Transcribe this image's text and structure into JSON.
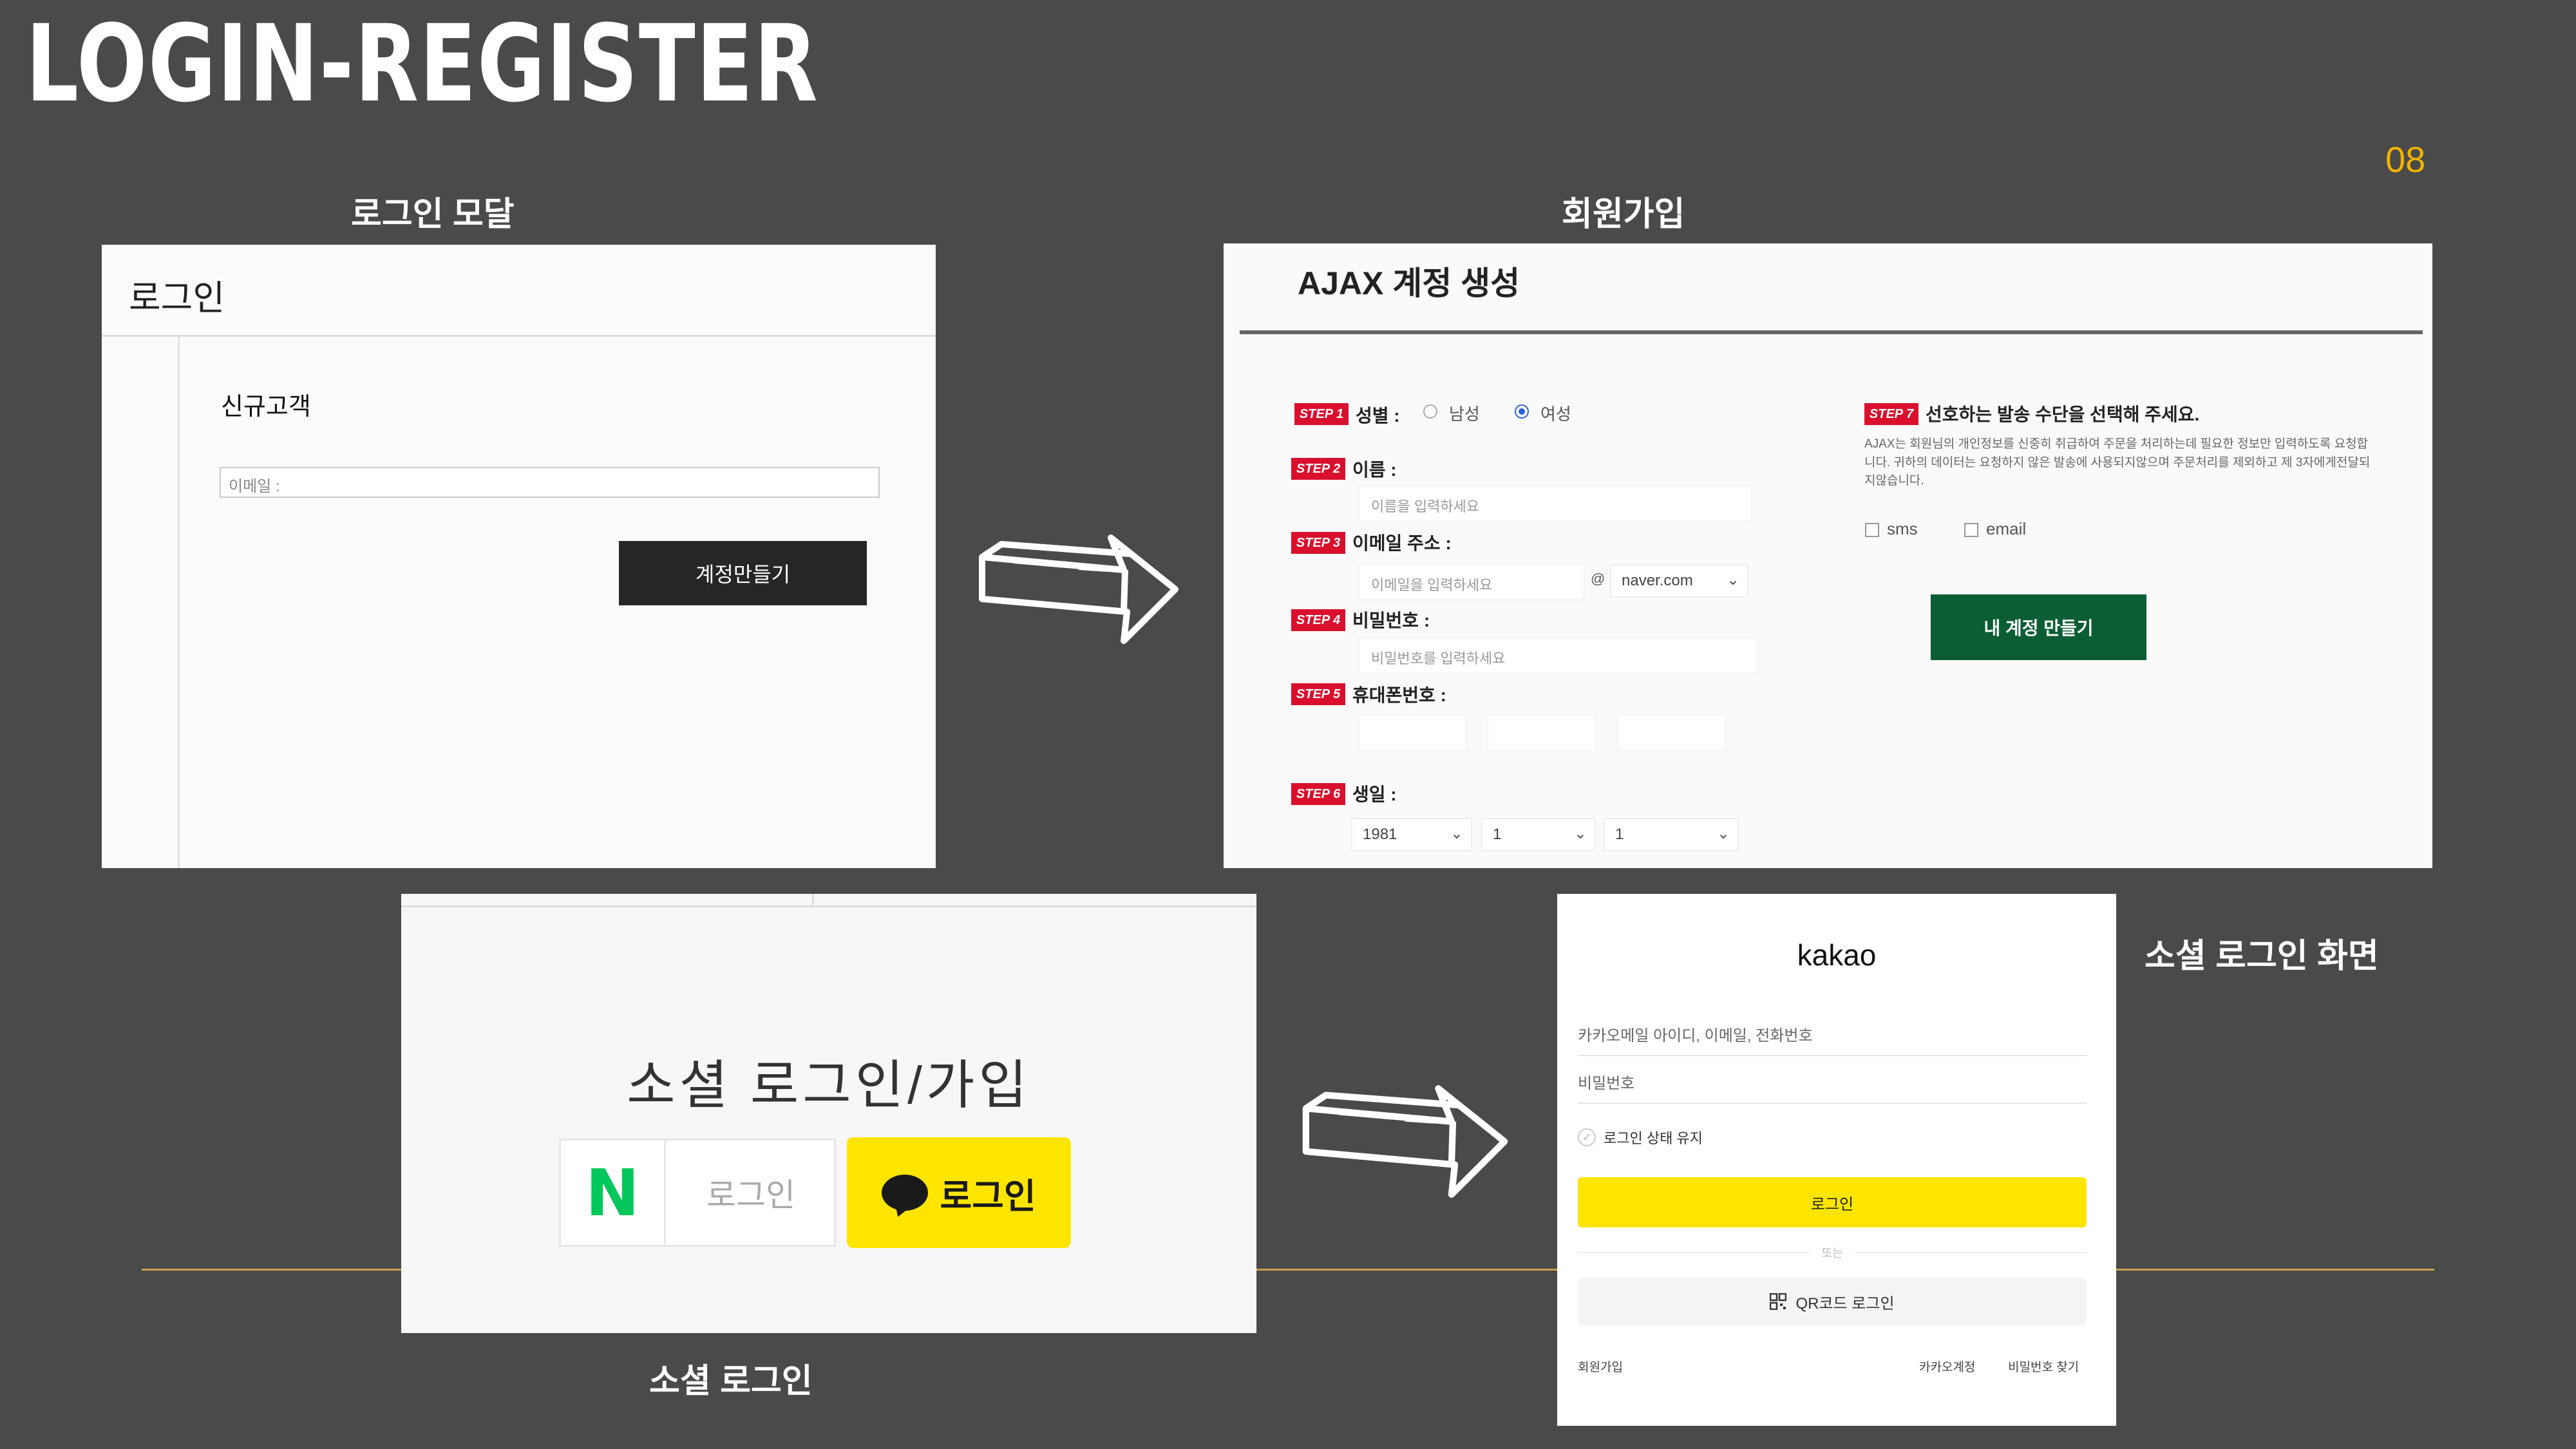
{
  "title": "LOGIN-REGISTER",
  "page_number": "08",
  "captions": {
    "login_modal": "로그인 모달",
    "register": "회원가입",
    "social_login": "소셜 로그인",
    "social_login_screen": "소셜 로그인 화면"
  },
  "login_modal": {
    "header": "로그인",
    "section": "신규고객",
    "email_placeholder": "이메일 :",
    "create_button": "계정만들기"
  },
  "register": {
    "title": "AJAX 계정 생성",
    "steps": {
      "s1": "STEP 1",
      "s2": "STEP 2",
      "s3": "STEP 3",
      "s4": "STEP 4",
      "s5": "STEP 5",
      "s6": "STEP 6",
      "s7": "STEP 7"
    },
    "gender_label": "성별 :",
    "gender_options": [
      "남성",
      "여성"
    ],
    "gender_selected": "여성",
    "name_label": "이름 :",
    "name_placeholder": "이름을 입력하세요",
    "email_label": "이메일 주소 :",
    "email_placeholder": "이메일을 입력하세요",
    "email_at": "@",
    "email_domain": "naver.com",
    "password_label": "비밀번호 :",
    "password_placeholder": "비밀번호를 입력하세요",
    "phone_label": "휴대폰번호 :",
    "birth_label": "생일 :",
    "birth_year": "1981",
    "birth_month": "1",
    "birth_day": "1",
    "preference_label": "선호하는 발송 수단을 선택해 주세요.",
    "preference_desc": "AJAX는 회원님의 개인정보를 신중히 취급하여 주문을 처리하는데 필요한 정보만 입력하도록 요청합니다. 귀하의 데이터는 요청하지 않은 발송에 사용되지않으며 주문처리를 제외하고 제 3자에게전달되지않습니다.",
    "option_sms": "sms",
    "option_email": "email",
    "submit_button": "내 계정 만들기"
  },
  "social": {
    "title": "소셜 로그인/가입",
    "naver_letter": "N",
    "naver_label": "로그인",
    "kakao_label": "로그인"
  },
  "kakao_screen": {
    "logo": "kakao",
    "id_placeholder": "카카오메일 아이디, 이메일, 전화번호",
    "password_placeholder": "비밀번호",
    "keep_login": "로그인 상태 유지",
    "login_button": "로그인",
    "or_text": "또는",
    "qr_login": "QR코드 로그인",
    "signup": "회원가입",
    "kakao_account": "카카오계정",
    "find_password": "비밀번호 찾기"
  },
  "colors": {
    "background": "#4a4a4a",
    "accent_line": "#c7a04a",
    "page_number": "#f0b400",
    "step_red": "#d90f2d",
    "submit_green": "#0b5e34",
    "kakao_yellow": "#fee500",
    "naver_green": "#03c75a"
  }
}
